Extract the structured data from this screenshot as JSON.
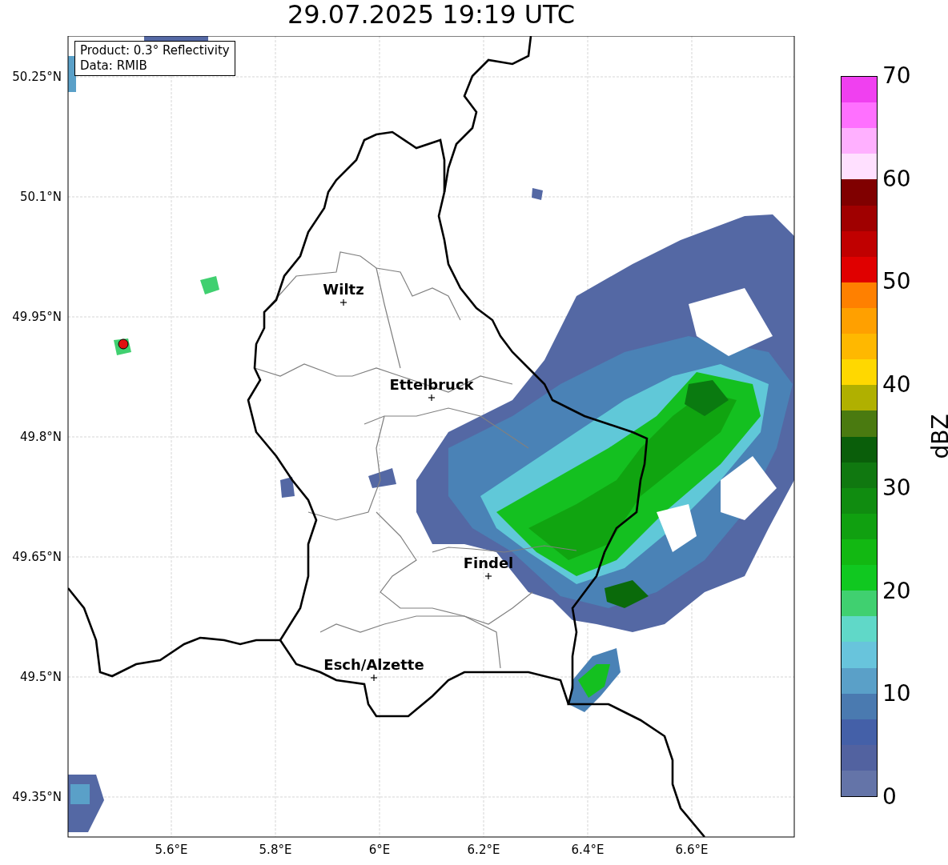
{
  "title": "29.07.2025 19:19 UTC",
  "info_box": [
    "Product: 0.3° Reflectivity",
    "Data: RMIB"
  ],
  "map": {
    "lat_ticks": [
      "50.25°N",
      "50.1°N",
      "49.95°N",
      "49.8°N",
      "49.65°N",
      "49.5°N",
      "49.35°N"
    ],
    "lon_ticks": [
      "5.6°E",
      "5.8°E",
      "6°E",
      "6.2°E",
      "6.4°E",
      "6.6°E"
    ],
    "cities": [
      {
        "name": "Wiltz"
      },
      {
        "name": "Ettelbruck"
      },
      {
        "name": "Findel"
      },
      {
        "name": "Esch/Alzette"
      }
    ]
  },
  "colorbar": {
    "label": "dBZ",
    "ticks": [
      "70",
      "60",
      "50",
      "40",
      "30",
      "20",
      "10",
      "0"
    ],
    "steps": [
      {
        "color": "#f040f0"
      },
      {
        "color": "#ff70ff"
      },
      {
        "color": "#ffb0ff"
      },
      {
        "color": "#ffe0ff"
      },
      {
        "color": "#800000"
      },
      {
        "color": "#a00000"
      },
      {
        "color": "#c00000"
      },
      {
        "color": "#e00000"
      },
      {
        "color": "#ff8000"
      },
      {
        "color": "#ffa000"
      },
      {
        "color": "#ffb800"
      },
      {
        "color": "#ffd800"
      },
      {
        "color": "#b0b000"
      },
      {
        "color": "#4a7a10"
      },
      {
        "color": "#0a5e0a"
      },
      {
        "color": "#107810"
      },
      {
        "color": "#108c10"
      },
      {
        "color": "#10a010"
      },
      {
        "color": "#12b812"
      },
      {
        "color": "#10c820"
      },
      {
        "color": "#40d070"
      },
      {
        "color": "#60d8c8"
      },
      {
        "color": "#68c4dc"
      },
      {
        "color": "#5aa0c8"
      },
      {
        "color": "#4a7ab0"
      },
      {
        "color": "#4460a8"
      },
      {
        "color": "#5262a0"
      },
      {
        "color": "#6474a8"
      }
    ]
  }
}
